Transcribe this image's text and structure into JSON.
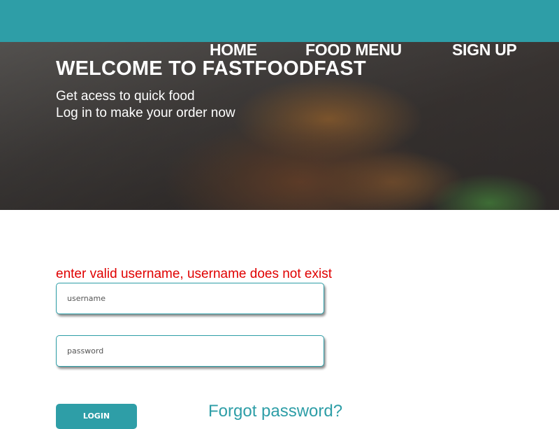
{
  "nav": {
    "home": "HOME",
    "food_menu": "FOOD MENU",
    "sign_up": "SIGN UP"
  },
  "hero": {
    "title": "WELCOME TO FASTFOODFAST",
    "line1": "Get acess to quick food",
    "line2": "Log in to make your order now"
  },
  "form": {
    "error": "enter valid username, username does not exist",
    "username_placeholder": "username",
    "password_placeholder": "password",
    "login_label": "LOGIN",
    "forgot_label": "Forgot password?"
  },
  "colors": {
    "accent": "#2e9ea7",
    "error": "#e00000"
  }
}
